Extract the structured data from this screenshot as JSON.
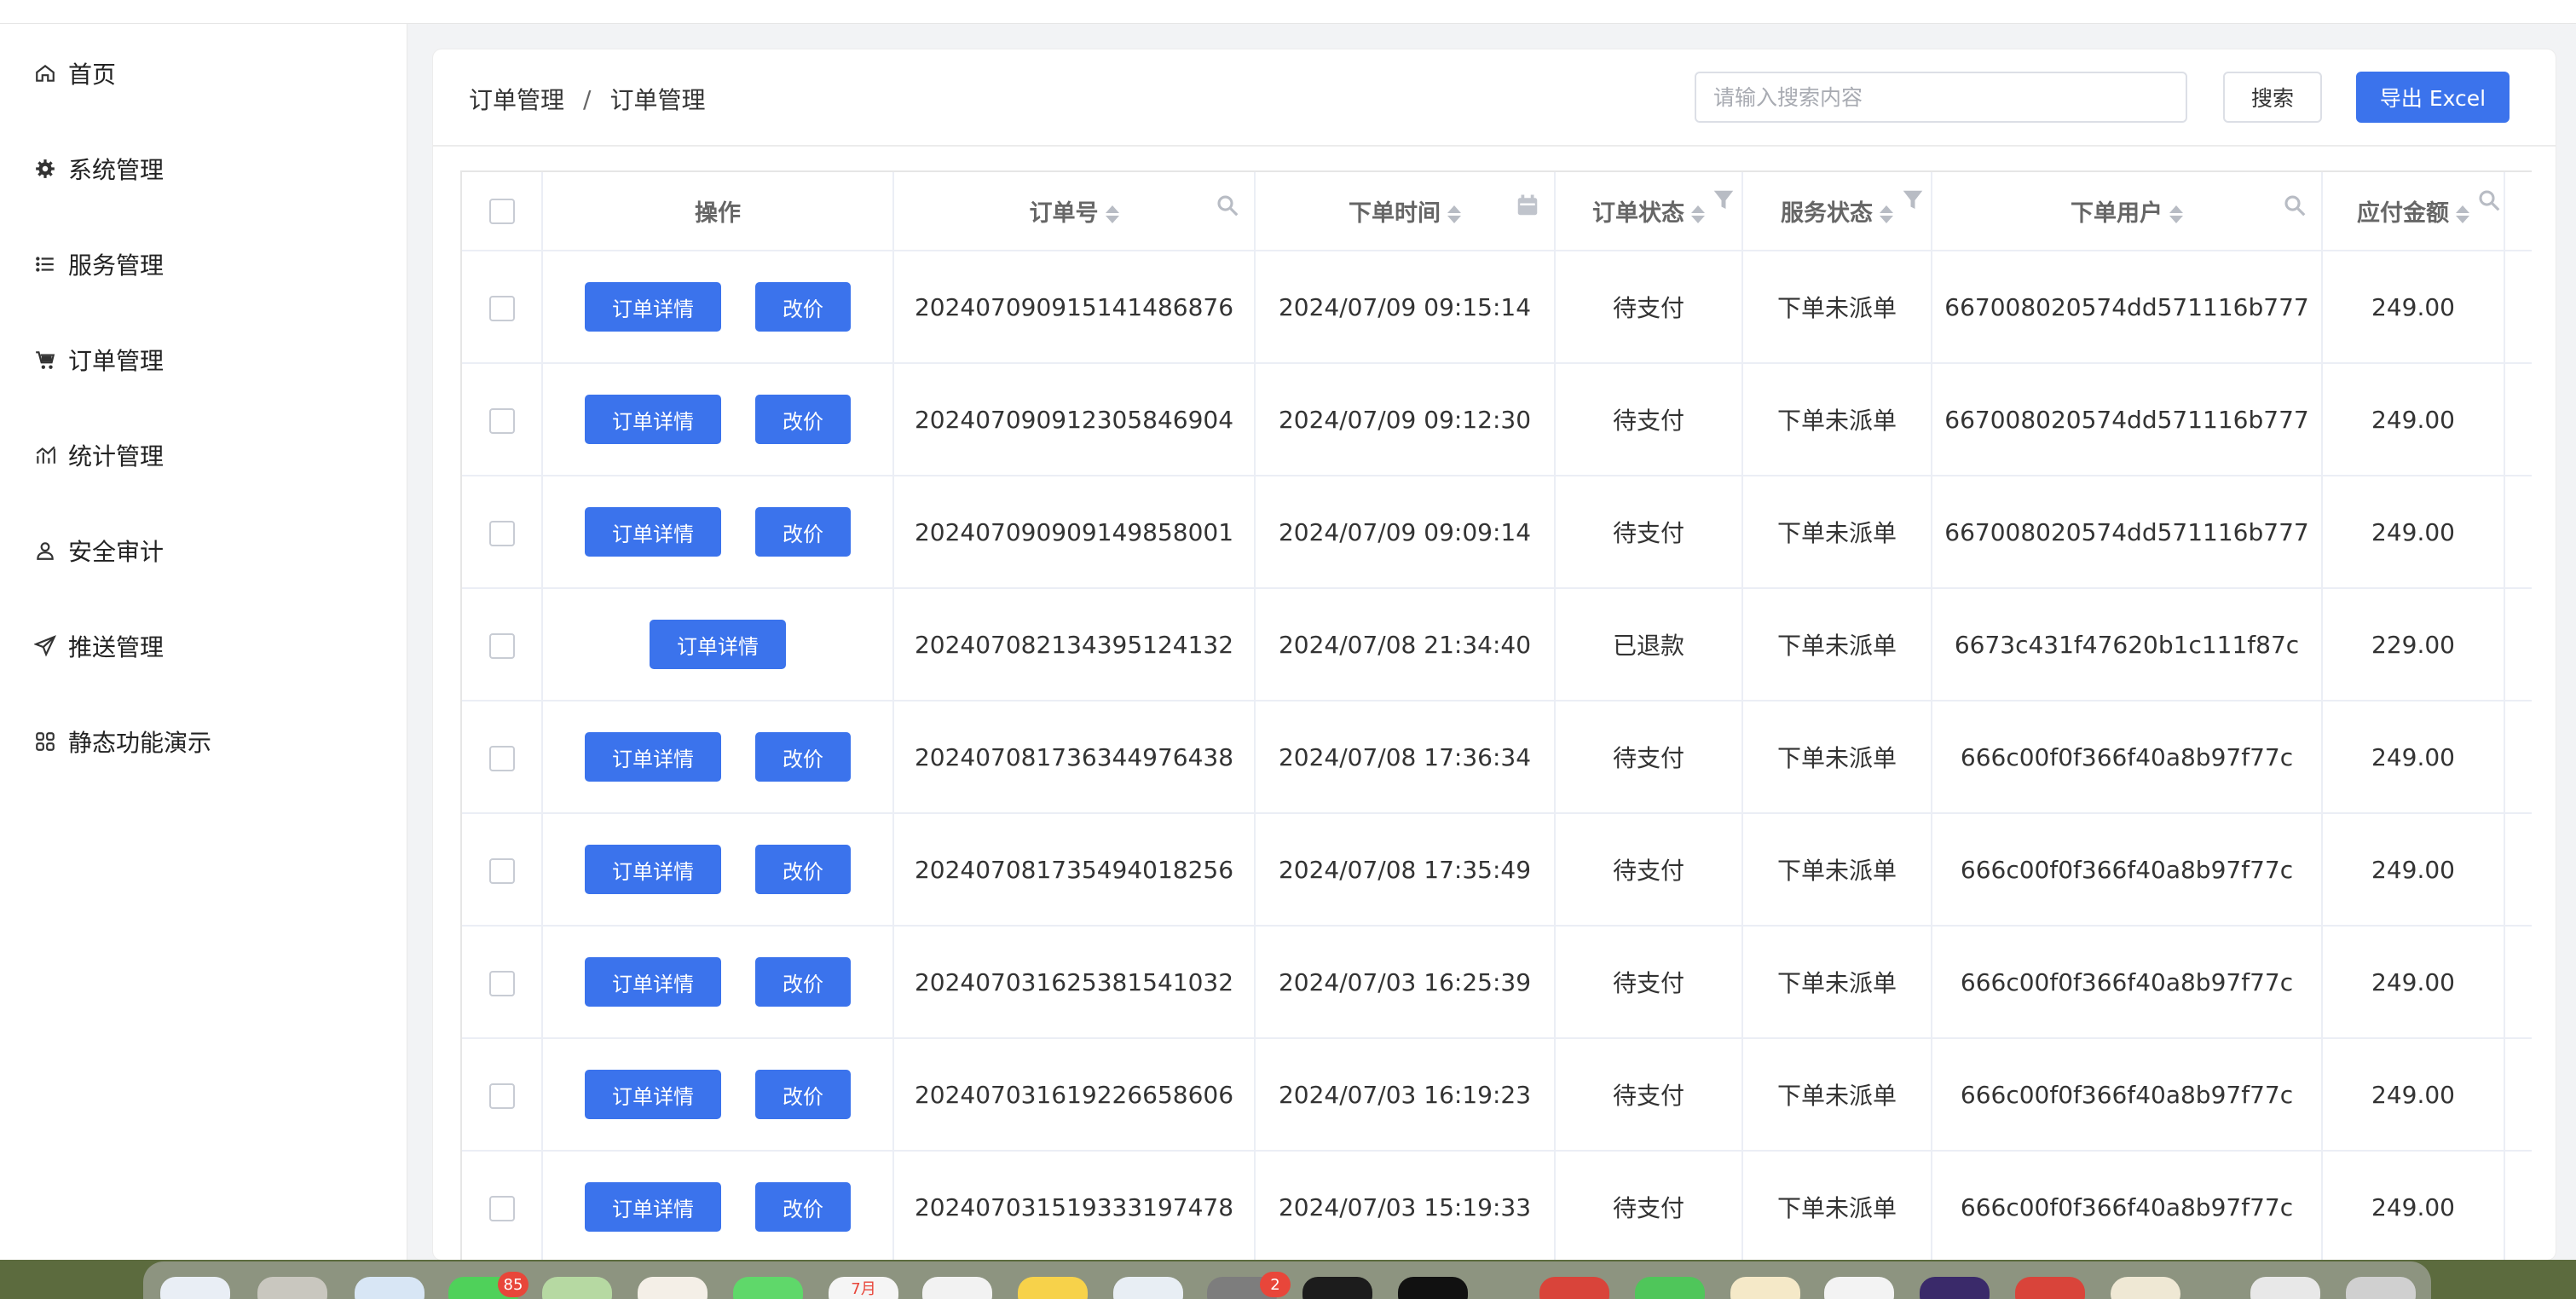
{
  "sidebar": {
    "items": [
      {
        "label": "首页",
        "icon": "home-icon"
      },
      {
        "label": "系统管理",
        "icon": "gear-icon"
      },
      {
        "label": "服务管理",
        "icon": "list-icon"
      },
      {
        "label": "订单管理",
        "icon": "cart-icon"
      },
      {
        "label": "统计管理",
        "icon": "chart-icon"
      },
      {
        "label": "安全审计",
        "icon": "user-icon"
      },
      {
        "label": "推送管理",
        "icon": "send-icon"
      },
      {
        "label": "静态功能演示",
        "icon": "grid-icon"
      }
    ]
  },
  "breadcrumb": {
    "parent": "订单管理",
    "separator": "/",
    "current": "订单管理"
  },
  "search": {
    "placeholder": "请输入搜索内容",
    "button_label": "搜索"
  },
  "export": {
    "label": "导出 Excel"
  },
  "table": {
    "headers": {
      "actions": "操作",
      "order_no": "订单号",
      "order_time": "下单时间",
      "order_status": "订单状态",
      "service_status": "服务状态",
      "user": "下单用户",
      "amount": "应付金额"
    },
    "buttons": {
      "detail": "订单详情",
      "reprice": "改价"
    },
    "rows": [
      {
        "order_no": "20240709091514148687​6",
        "time": "2024/07/09 09:15:14",
        "status": "待支付",
        "service": "下单未派单",
        "user": "667008020574dd571116b777",
        "amount": "249.00",
        "reprice": true
      },
      {
        "order_no": "20240709091230584690​4",
        "time": "2024/07/09 09:12:30",
        "status": "待支付",
        "service": "下单未派单",
        "user": "667008020574dd571116b777",
        "amount": "249.00",
        "reprice": true
      },
      {
        "order_no": "20240709090914985800​1",
        "time": "2024/07/09 09:09:14",
        "status": "待支付",
        "service": "下单未派单",
        "user": "667008020574dd571116b777",
        "amount": "249.00",
        "reprice": true
      },
      {
        "order_no": "20240708213439512413​2",
        "time": "2024/07/08 21:34:40",
        "status": "已退款",
        "service": "下单未派单",
        "user": "6673c431f47620b1c111f87c",
        "amount": "229.00",
        "reprice": false
      },
      {
        "order_no": "20240708173634497643​8",
        "time": "2024/07/08 17:36:34",
        "status": "待支付",
        "service": "下单未派单",
        "user": "666c00f0f366f40a8b97f77c",
        "amount": "249.00",
        "reprice": true
      },
      {
        "order_no": "20240708173549401825​6",
        "time": "2024/07/08 17:35:49",
        "status": "待支付",
        "service": "下单未派单",
        "user": "666c00f0f366f40a8b97f77c",
        "amount": "249.00",
        "reprice": true
      },
      {
        "order_no": "20240703162538154103​2",
        "time": "2024/07/03 16:25:39",
        "status": "待支付",
        "service": "下单未派单",
        "user": "666c00f0f366f40a8b97f77c",
        "amount": "249.00",
        "reprice": true
      },
      {
        "order_no": "20240703161922665860​6",
        "time": "2024/07/03 16:19:23",
        "status": "待支付",
        "service": "下单未派单",
        "user": "666c00f0f366f40a8b97f77c",
        "amount": "249.00",
        "reprice": true
      },
      {
        "order_no": "20240703151933319747​8",
        "time": "2024/07/03 15:19:33",
        "status": "待支付",
        "service": "下单未派单",
        "user": "666c00f0f366f40a8b97f77c",
        "amount": "249.00",
        "reprice": true
      }
    ]
  },
  "dock": {
    "badges": [
      "85",
      "2"
    ],
    "calendar_label": "7月"
  },
  "colors": {
    "primary": "#3b73ec",
    "border": "#ebeef5"
  }
}
